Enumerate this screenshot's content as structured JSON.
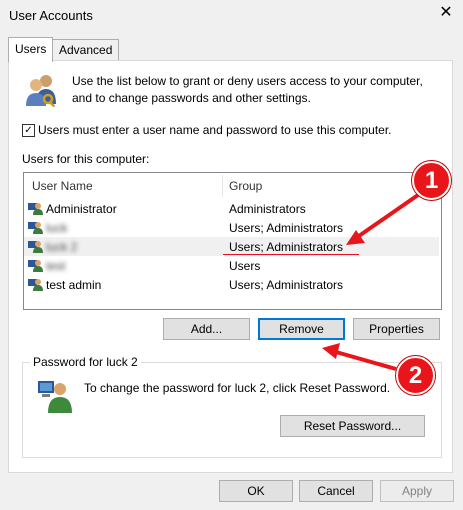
{
  "window": {
    "title": "User Accounts",
    "close_glyph": "✕"
  },
  "tabs": [
    {
      "label": "Users",
      "active": true
    },
    {
      "label": "Advanced",
      "active": false
    }
  ],
  "intro": {
    "text": "Use the list below to grant or deny users access to your computer, and to change passwords and other settings."
  },
  "checkbox": {
    "checked": true,
    "mark": "✓",
    "label": "Users must enter a user name and password to use this computer."
  },
  "users_section_label": "Users for this computer:",
  "table": {
    "headers": {
      "name": "User Name",
      "group": "Group"
    },
    "rows": [
      {
        "name": "Administrator",
        "group": "Administrators",
        "blurred": false,
        "selected": false
      },
      {
        "name": "luck",
        "group": "Users; Administrators",
        "blurred": true,
        "selected": false
      },
      {
        "name": "luck 2",
        "group": "Users; Administrators",
        "blurred": true,
        "selected": true
      },
      {
        "name": "test",
        "group": "Users",
        "blurred": true,
        "selected": false
      },
      {
        "name": "test admin",
        "group": "Users; Administrators",
        "blurred": false,
        "selected": false
      }
    ]
  },
  "buttons": {
    "add": "Add...",
    "remove": "Remove",
    "properties": "Properties",
    "reset_password": "Reset Password...",
    "ok": "OK",
    "cancel": "Cancel",
    "apply": "Apply"
  },
  "password_group": {
    "title": "Password for luck 2",
    "text": "To change the password for luck 2, click Reset Password."
  },
  "annotations": {
    "badge1": "1",
    "badge2": "2",
    "color": "#e8151b"
  },
  "icons": {
    "users": "users-key-icon",
    "user": "user-icon",
    "password_user": "user-password-icon"
  }
}
